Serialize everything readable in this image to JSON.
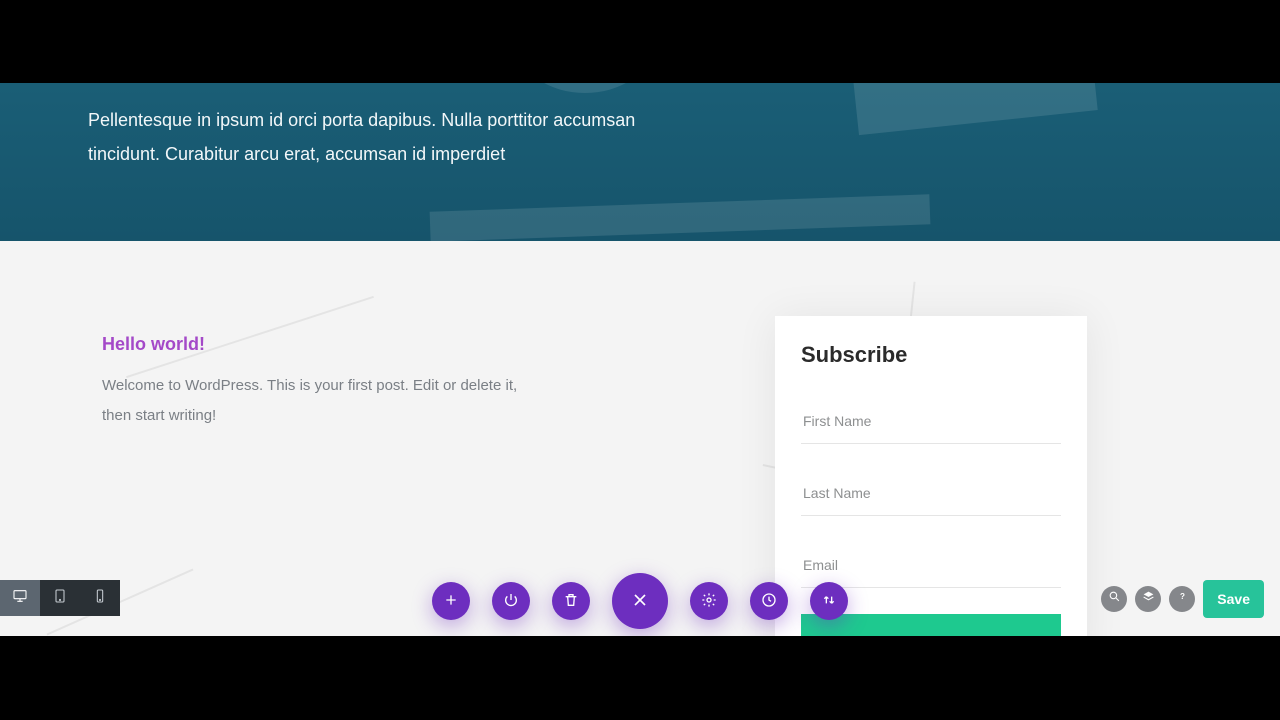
{
  "hero": {
    "text": "Pellentesque in ipsum id orci porta dapibus. Nulla porttitor accumsan tincidunt. Curabitur arcu erat, accumsan id imperdiet"
  },
  "post": {
    "title": "Hello world!",
    "body": "Welcome to WordPress. This is your first post. Edit or delete it, then start writing!"
  },
  "subscribe": {
    "heading": "Subscribe",
    "first_name_placeholder": "First Name",
    "last_name_placeholder": "Last Name",
    "email_placeholder": "Email"
  },
  "toolbar": {
    "save_label": "Save"
  }
}
